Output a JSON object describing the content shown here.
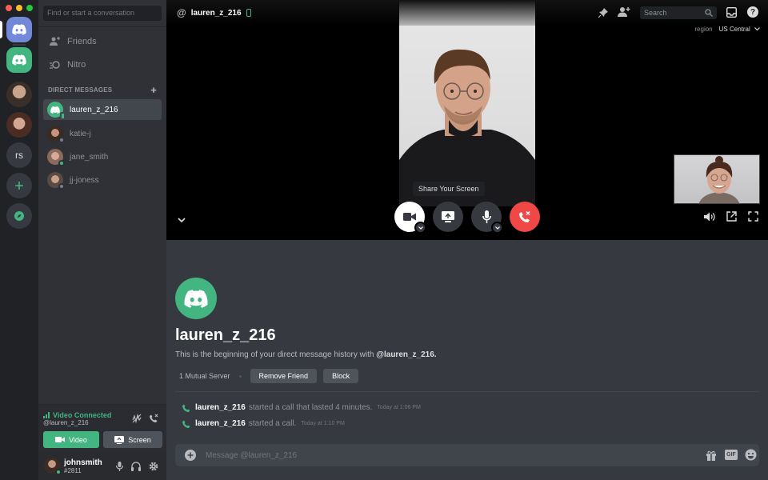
{
  "window": {
    "traffic_colors": [
      "#ff5f57",
      "#febc2e",
      "#28c840"
    ]
  },
  "rail": {
    "home_color": "#7289da",
    "items": [
      {
        "name": "server-dm-green",
        "color": "#43b581"
      },
      {
        "name": "server-avatar-man",
        "color": "#8a6a5a"
      },
      {
        "name": "server-avatar-woman",
        "color": "#6a4a3a"
      },
      {
        "name": "server-rs",
        "label": "rs"
      }
    ],
    "add_color": "#43b581"
  },
  "sidebar": {
    "search_placeholder": "Find or start a conversation",
    "nav": [
      {
        "label": "Friends"
      },
      {
        "label": "Nitro"
      }
    ],
    "dm_header": "DIRECT MESSAGES",
    "dm_add": "+",
    "dms": [
      {
        "name": "lauren_z_216",
        "active": true,
        "avatar_color": "#43b581",
        "status": "mobile"
      },
      {
        "name": "katie-j",
        "active": false,
        "avatar_color": "#7a5a4a",
        "status": "offline"
      },
      {
        "name": "jane_smith",
        "active": false,
        "avatar_color": "#b08a7a",
        "status": "online"
      },
      {
        "name": "jj-joness",
        "active": false,
        "avatar_color": "#9a7a6a",
        "status": "offline"
      }
    ]
  },
  "voice": {
    "status": "Video Connected",
    "channel": "@lauren_z_216",
    "video_label": "Video",
    "screen_label": "Screen"
  },
  "user": {
    "name": "johnsmith",
    "tag": "#2811"
  },
  "call": {
    "username": "lauren_z_216",
    "search_placeholder": "Search",
    "region_label": "region",
    "region_value": "US Central",
    "tooltip": "Share Your Screen"
  },
  "welcome": {
    "name": "lauren_z_216",
    "text_prefix": "This is the beginning of your direct message history with ",
    "text_user": "@lauren_z_216.",
    "mutual": "1 Mutual Server",
    "remove_friend": "Remove Friend",
    "block": "Block"
  },
  "messages": [
    {
      "user": "lauren_z_216",
      "text": "started a call that lasted 4 minutes.",
      "time": "Today at 1:06 PM"
    },
    {
      "user": "lauren_z_216",
      "text": "started a call.",
      "time": "Today at 1:10 PM"
    }
  ],
  "composer": {
    "placeholder": "Message @lauren_z_216"
  },
  "colors": {
    "blurple": "#7289da",
    "green": "#43b581",
    "red": "#f04747",
    "bg": "#36393f"
  }
}
